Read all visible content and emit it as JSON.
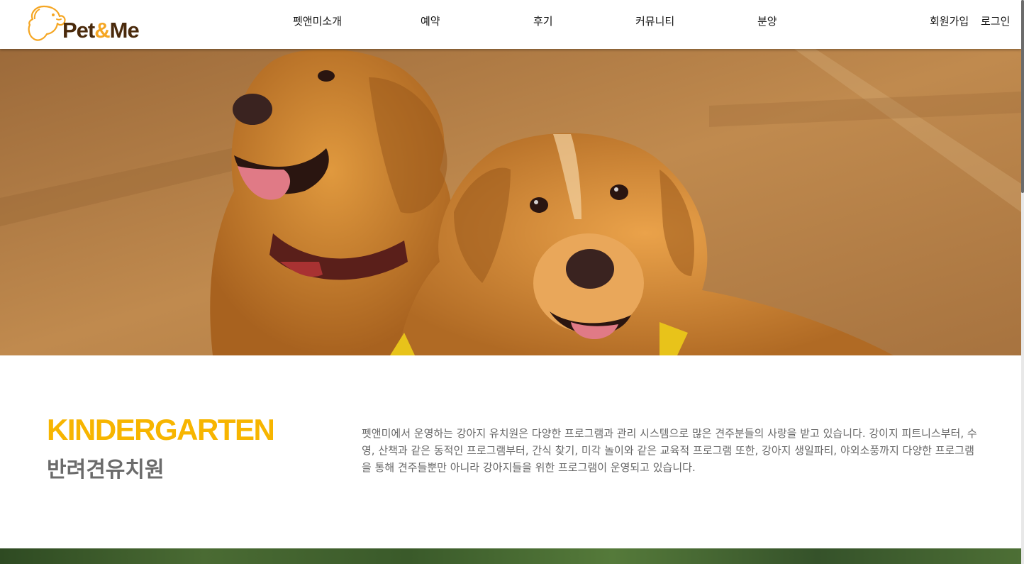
{
  "logo": {
    "brand_prefix": "Pet",
    "brand_amp": "&",
    "brand_suffix": "Me",
    "icon": "dog-head-icon"
  },
  "nav": {
    "items": [
      {
        "label": "펫앤미소개"
      },
      {
        "label": "예약"
      },
      {
        "label": "후기"
      },
      {
        "label": "커뮤니티"
      },
      {
        "label": "분양"
      }
    ]
  },
  "auth": {
    "signup_label": "회원가입",
    "login_label": "로그인"
  },
  "hero": {
    "image": "two-golden-retrievers-photo"
  },
  "intro": {
    "title_en": "KINDERGARTEN",
    "title_ko": "반려견유치원",
    "description": "펫앤미에서 운영하는 강아지 유치원은 다양한 프로그램과 관리 시스템으로 많은 견주분들의 사랑을 받고 있습니다. 강이지 피트니스부터, 수영, 산책과 같은 동적인 프로그램부터, 간식 찾기, 미각 놀이와 같은 교육적 프로그램 또한, 강아지 생일파티, 야외소풍까지 다양한 프로그램을 통해 견주들뿐만 아니라 강아지들을 위한 프로그램이 운영되고 있습니다."
  },
  "colors": {
    "accent": "#f7b500",
    "brand_brown": "#4a2a0c",
    "logo_orange": "#f5a623",
    "subtitle_gray": "#6b6b6b"
  }
}
